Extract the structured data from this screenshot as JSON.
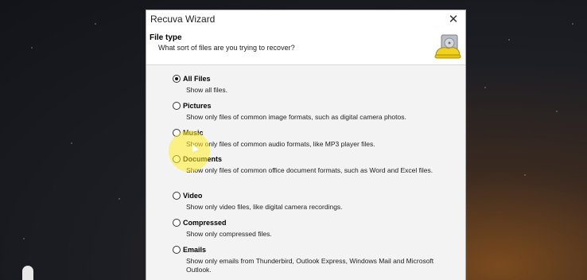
{
  "window": {
    "title": "Recuva Wizard",
    "close_glyph": "✕"
  },
  "header": {
    "title": "File type",
    "subtitle": "What sort of files are you trying to recover?",
    "icon": "recuva-hardhat-drive-icon"
  },
  "options": [
    {
      "label": "All Files",
      "desc": "Show all files.",
      "selected": true
    },
    {
      "label": "Pictures",
      "desc": "Show only files of common image formats, such as digital camera photos.",
      "selected": false
    },
    {
      "label": "Music",
      "desc": "Show only files of common audio formats, like MP3 player files.",
      "selected": false
    },
    {
      "label": "Documents",
      "desc": "Show only files of common office document formats, such as Word and Excel files.",
      "selected": false
    },
    {
      "label": "Video",
      "desc": "Show only video files, like digital camera recordings.",
      "selected": false
    },
    {
      "label": "Compressed",
      "desc": "Show only compressed files.",
      "selected": false
    },
    {
      "label": "Emails",
      "desc": "Show only emails from Thunderbird, Outlook Express, Windows Mail and Microsoft Outlook.",
      "selected": false
    }
  ],
  "colors": {
    "highlight": "#ffec28",
    "window_bg": "#f3f3f3"
  }
}
